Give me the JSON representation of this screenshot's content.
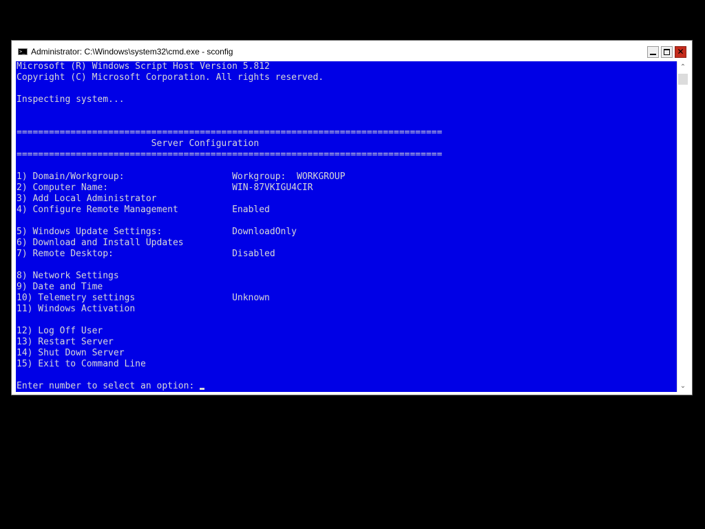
{
  "window": {
    "title": "Administrator: C:\\Windows\\system32\\cmd.exe - sconfig",
    "icon": "cmd-console-icon",
    "icon_glyph": ">_",
    "controls": {
      "minimize": "minimize-icon",
      "maximize": "maximize-icon",
      "close": "close-icon",
      "close_glyph": "✕"
    }
  },
  "console": {
    "header": [
      "Microsoft (R) Windows Script Host Version 5.812",
      "Copyright (C) Microsoft Corporation. All rights reserved."
    ],
    "status": "Inspecting system...",
    "separator": "===============================================================================",
    "section_title": "                         Server Configuration",
    "menu": [
      {
        "label": "1) Domain/Workgroup:",
        "value": "Workgroup:  WORKGROUP"
      },
      {
        "label": "2) Computer Name:",
        "value": "WIN-87VKIGU4CIR"
      },
      {
        "label": "3) Add Local Administrator",
        "value": ""
      },
      {
        "label": "4) Configure Remote Management",
        "value": "Enabled"
      },
      {
        "label": "",
        "value": ""
      },
      {
        "label": "5) Windows Update Settings:",
        "value": "DownloadOnly"
      },
      {
        "label": "6) Download and Install Updates",
        "value": ""
      },
      {
        "label": "7) Remote Desktop:",
        "value": "Disabled"
      },
      {
        "label": "",
        "value": ""
      },
      {
        "label": "8) Network Settings",
        "value": ""
      },
      {
        "label": "9) Date and Time",
        "value": ""
      },
      {
        "label": "10) Telemetry settings",
        "value": "Unknown"
      },
      {
        "label": "11) Windows Activation",
        "value": ""
      },
      {
        "label": "",
        "value": ""
      },
      {
        "label": "12) Log Off User",
        "value": ""
      },
      {
        "label": "13) Restart Server",
        "value": ""
      },
      {
        "label": "14) Shut Down Server",
        "value": ""
      },
      {
        "label": "15) Exit to Command Line",
        "value": ""
      }
    ],
    "prompt": "Enter number to select an option: "
  },
  "scrollbar": {
    "up_glyph": "⌃",
    "down_glyph": "⌄"
  },
  "colors": {
    "console_bg": "#0000e6",
    "console_fg": "#d8d8d8",
    "close_button": "#c42b1c"
  }
}
